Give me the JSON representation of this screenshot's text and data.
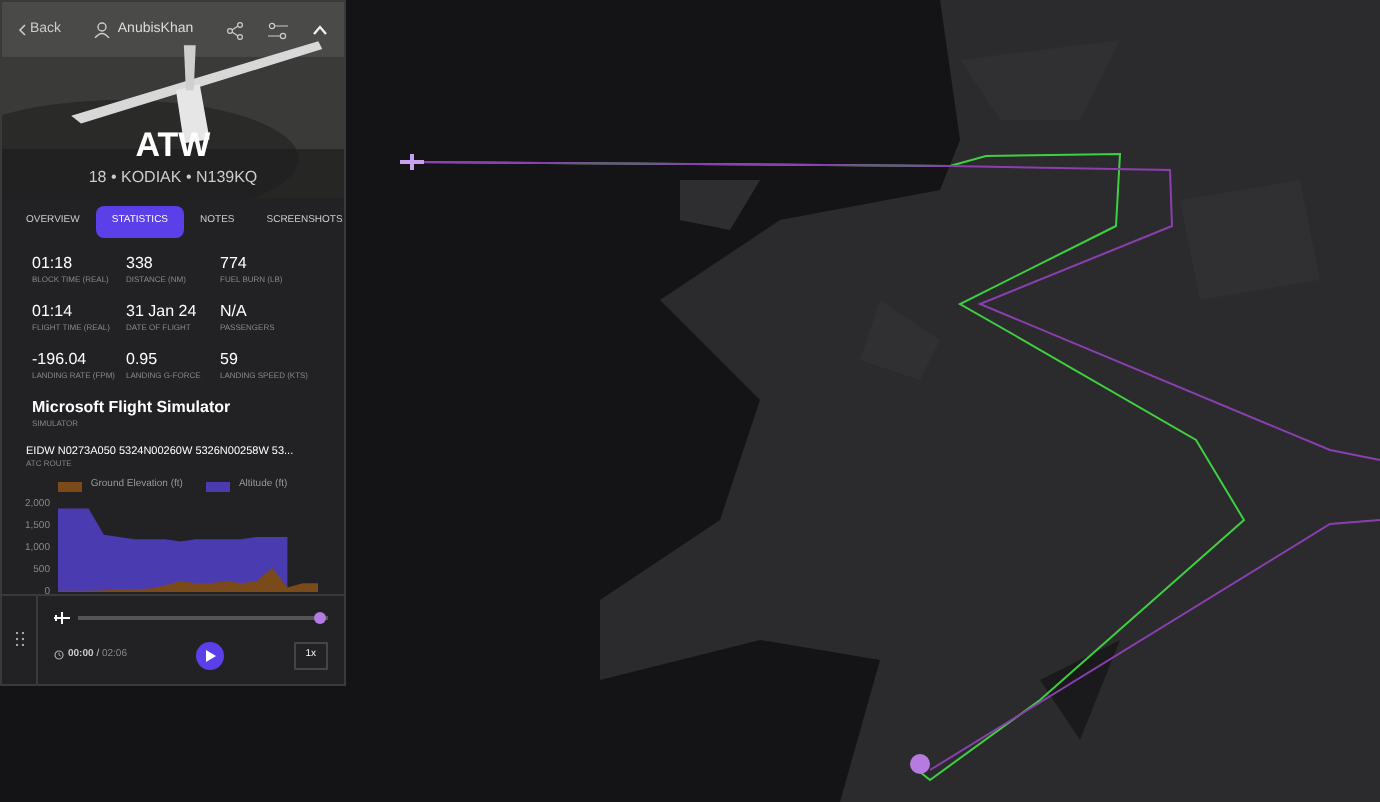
{
  "header": {
    "back": "Back",
    "user": "AnubisKhan"
  },
  "flight": {
    "title": "ATW",
    "subtitle": "18 • KODIAK • N139KQ"
  },
  "tabs": [
    {
      "label": "OVERVIEW",
      "selected": false
    },
    {
      "label": "STATISTICS",
      "selected": true
    },
    {
      "label": "NOTES",
      "selected": false
    },
    {
      "label": "SCREENSHOTS",
      "selected": false
    }
  ],
  "stats": [
    {
      "value": "01:18",
      "label": "BLOCK TIME (REAL)"
    },
    {
      "value": "338",
      "label": "DISTANCE (NM)"
    },
    {
      "value": "774",
      "label": "FUEL BURN (LB)"
    },
    {
      "value": "01:14",
      "label": "FLIGHT TIME (REAL)"
    },
    {
      "value": "31 Jan 24",
      "label": "DATE OF FLIGHT"
    },
    {
      "value": "N/A",
      "label": "PASSENGERS"
    },
    {
      "value": "-196.04",
      "label": "LANDING RATE (FPM)"
    },
    {
      "value": "0.95",
      "label": "LANDING G-FORCE"
    },
    {
      "value": "59",
      "label": "LANDING SPEED (KTS)"
    }
  ],
  "simulator": {
    "value": "Microsoft Flight Simulator",
    "label": "SIMULATOR"
  },
  "atc_route": {
    "value": "EIDW N0273A050 5324N00260W 5326N00258W 53...",
    "label": "ATC ROUTE"
  },
  "chart_data": {
    "type": "area",
    "legend": true,
    "yticks": [
      {
        "value": 0,
        "label": "0"
      },
      {
        "value": 500,
        "label": "500"
      },
      {
        "value": 1000,
        "label": "1,000"
      },
      {
        "value": 1500,
        "label": "1,500"
      },
      {
        "value": 2000,
        "label": "2,000"
      }
    ],
    "ylim": [
      0,
      2000
    ],
    "series": [
      {
        "name": "Ground Elevation (ft)",
        "color": "#7a4a1a",
        "values": [
          30,
          30,
          30,
          40,
          60,
          60,
          80,
          150,
          250,
          200,
          200,
          250,
          200,
          250,
          550,
          100,
          200,
          200
        ]
      },
      {
        "name": "Altitude (ft)",
        "color": "#4b3bb0",
        "values": [
          1900,
          1900,
          1900,
          1300,
          1250,
          1200,
          1200,
          1200,
          1150,
          1200,
          1200,
          1200,
          1200,
          1250,
          1250,
          1250,
          null,
          null
        ]
      }
    ]
  },
  "player": {
    "level": 0.97,
    "time": "00:00",
    "separator": "/",
    "duration": "02:06",
    "speed": "1x"
  }
}
